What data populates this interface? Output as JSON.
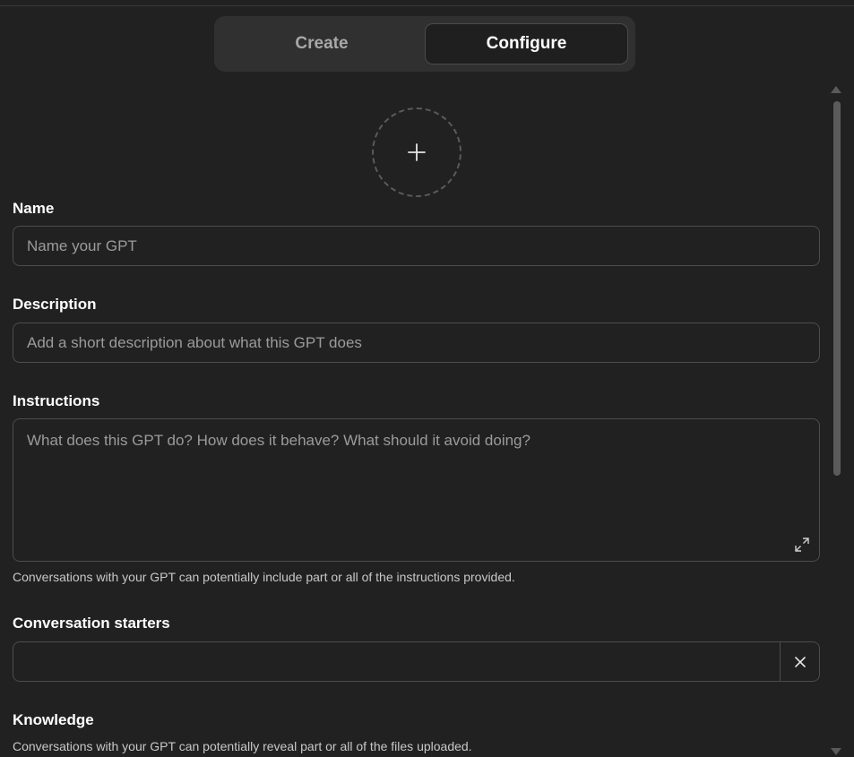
{
  "tabs": {
    "create_label": "Create",
    "configure_label": "Configure",
    "active": "Configure"
  },
  "avatar": {
    "icon": "plus-icon"
  },
  "name": {
    "label": "Name",
    "placeholder": "Name your GPT",
    "value": ""
  },
  "description": {
    "label": "Description",
    "placeholder": "Add a short description about what this GPT does",
    "value": ""
  },
  "instructions": {
    "label": "Instructions",
    "placeholder": "What does this GPT do? How does it behave? What should it avoid doing?",
    "value": "",
    "hint": "Conversations with your GPT can potentially include part or all of the instructions provided.",
    "expand_icon": "expand-icon"
  },
  "conversation_starters": {
    "label": "Conversation starters",
    "items": [
      ""
    ],
    "remove_icon": "close-icon"
  },
  "knowledge": {
    "label": "Knowledge",
    "hint": "Conversations with your GPT can potentially reveal part or all of the files uploaded."
  },
  "colors": {
    "background": "#212121",
    "tab_bar": "#303030",
    "active_tab": "#1f1f1f",
    "border": "#4d4d4d",
    "placeholder": "#9b9b9b"
  }
}
